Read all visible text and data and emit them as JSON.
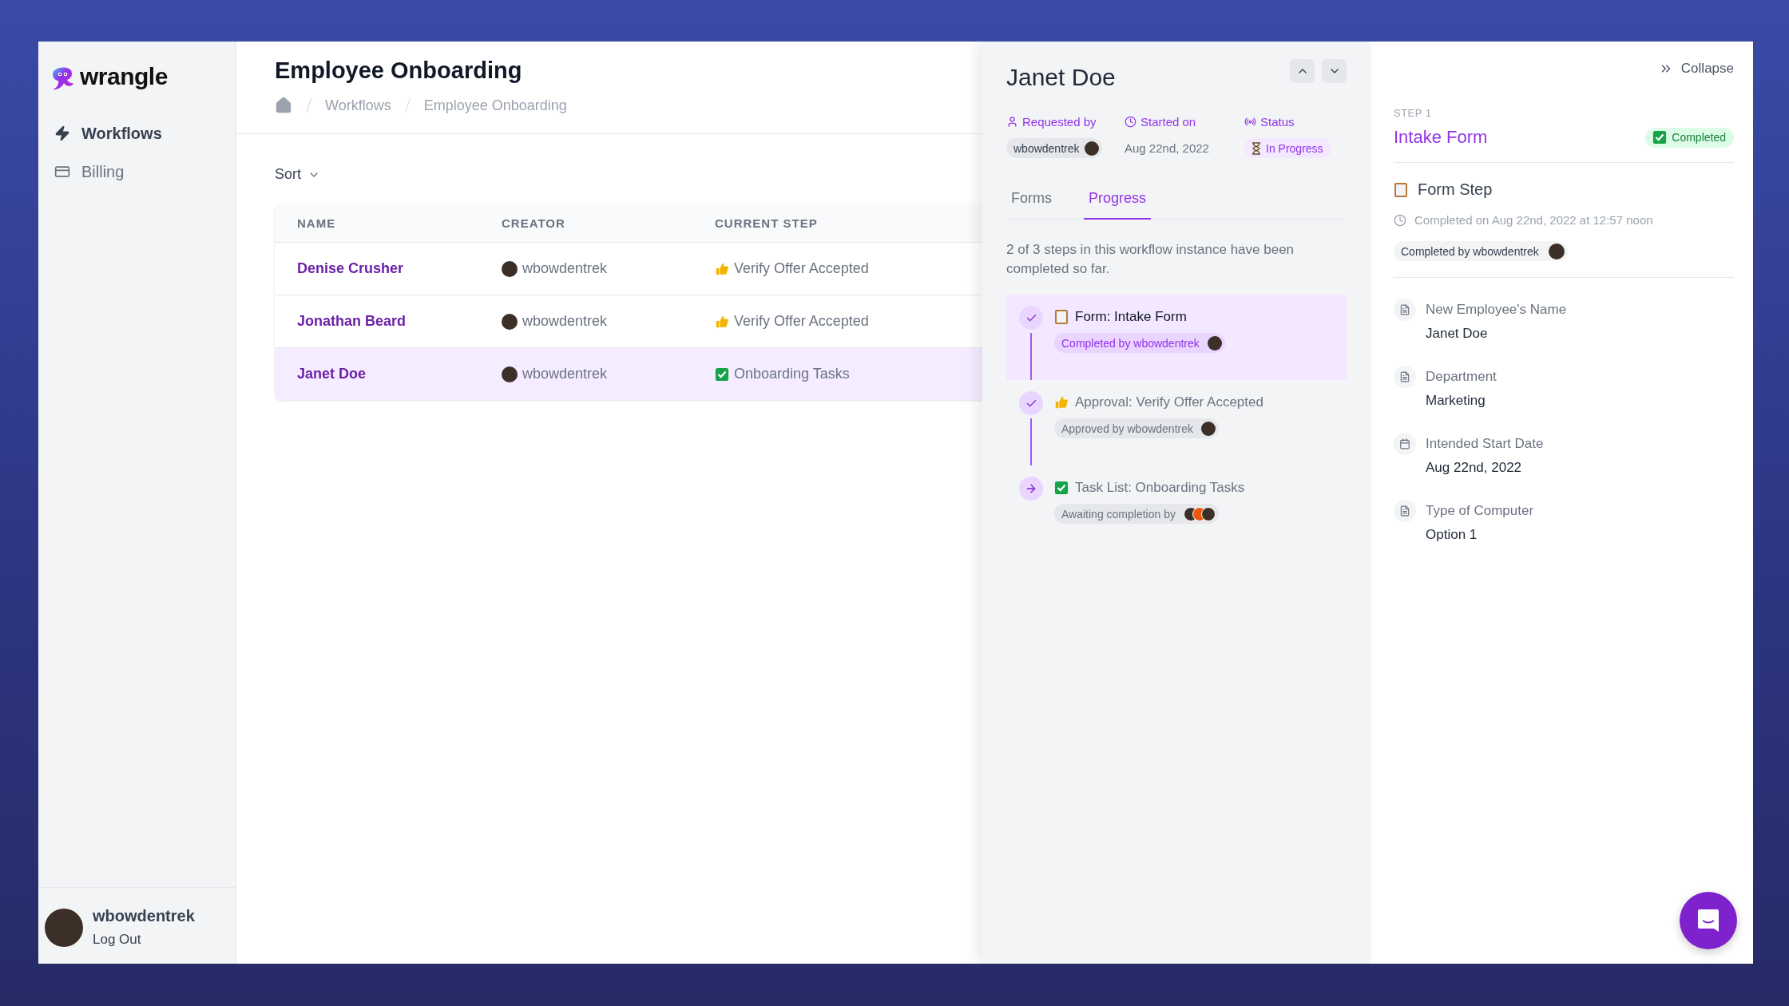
{
  "sidebar": {
    "brand": "wrangle",
    "nav": [
      {
        "label": "Workflows",
        "selected": true
      },
      {
        "label": "Billing",
        "selected": false
      }
    ],
    "user": {
      "name": "wbowdentrek",
      "action": "Log Out"
    }
  },
  "page": {
    "title": "Employee Onboarding",
    "breadcrumbs": [
      "Workflows",
      "Employee Onboarding"
    ],
    "sort": "Sort"
  },
  "table": {
    "columns": [
      "NAME",
      "CREATOR",
      "CURRENT STEP"
    ],
    "rows": [
      {
        "name": "Denise Crusher",
        "creator": "wbowdentrek",
        "step": "Verify Offer Accepted",
        "kind": "approval",
        "selected": false
      },
      {
        "name": "Jonathan Beard",
        "creator": "wbowdentrek",
        "step": "Verify Offer Accepted",
        "kind": "approval",
        "selected": false
      },
      {
        "name": "Janet Doe",
        "creator": "wbowdentrek",
        "step": "Onboarding Tasks",
        "kind": "task_list",
        "selected": true
      }
    ]
  },
  "detail": {
    "title": "Janet Doe",
    "requested_by": {
      "label": "Requested by",
      "value": "wbowdentrek"
    },
    "started_on": {
      "label": "Started on",
      "value": "Aug 22nd, 2022"
    },
    "status": {
      "label": "Status",
      "value": "In Progress"
    },
    "tabs": [
      {
        "label": "Forms",
        "selected": false
      },
      {
        "label": "Progress",
        "selected": true
      }
    ],
    "summary": "2 of 3 steps in this workflow instance have been completed so far.",
    "steps": [
      {
        "kind": "form",
        "title": "Form: Intake Form",
        "completed": true,
        "badge": "Completed by wbowdentrek",
        "group_assignees": false,
        "selected": true
      },
      {
        "kind": "approval",
        "title": "Approval: Verify Offer Accepted",
        "completed": true,
        "badge": "Approved by wbowdentrek",
        "group_assignees": false,
        "selected": false
      },
      {
        "kind": "task_list",
        "title": "Task List: Onboarding Tasks",
        "completed": false,
        "badge": "Awaiting completion by",
        "group_assignees": true,
        "selected": false
      }
    ]
  },
  "step_panel": {
    "collapse": "Collapse",
    "eyebrow": "STEP 1",
    "title": "Intake Form",
    "status": "Completed",
    "step_type": "Form Step",
    "completed_on": "Completed on Aug 22nd, 2022 at 12:57 noon",
    "completed_by": "Completed by wbowdentrek",
    "fields": [
      {
        "label": "New Employee's Name",
        "value": "Janet Doe",
        "kind": "text"
      },
      {
        "label": "Department",
        "value": "Marketing",
        "kind": "text"
      },
      {
        "label": "Intended Start Date",
        "value": "Aug 22nd, 2022",
        "kind": "date"
      },
      {
        "label": "Type of Computer",
        "value": "Option 1",
        "kind": "text"
      }
    ]
  }
}
